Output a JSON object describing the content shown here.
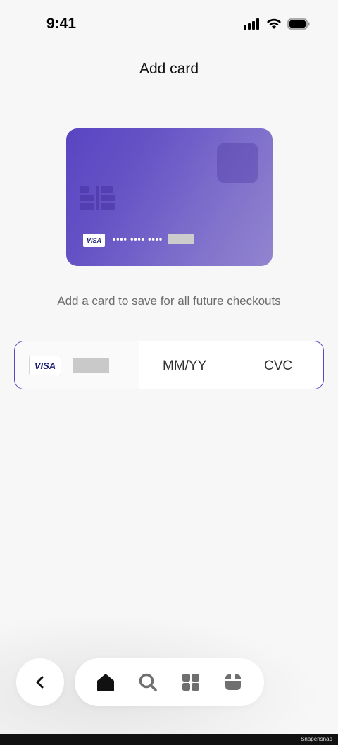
{
  "status_bar": {
    "time": "9:41",
    "icons": [
      "signal-icon",
      "wifi-icon",
      "battery-icon"
    ]
  },
  "header": {
    "title": "Add card"
  },
  "card_preview": {
    "brand": "VISA",
    "number_masked": "•••• •••• ••••"
  },
  "subtitle": "Add a card to save for all future checkouts",
  "card_input": {
    "brand": "VISA",
    "expiry_placeholder": "MM/YY",
    "cvc_placeholder": "CVC"
  },
  "nav": {
    "back_icon": "chevron-left-icon",
    "tabs": [
      {
        "icon": "home-icon",
        "active": true
      },
      {
        "icon": "search-icon",
        "active": false
      },
      {
        "icon": "grid-icon",
        "active": false
      },
      {
        "icon": "box-icon",
        "active": false
      }
    ]
  },
  "footer": {
    "watermark": "Snapensnap"
  },
  "colors": {
    "accent": "#5a45c2",
    "background": "#f7f7f7",
    "active_icon": "#111111",
    "inactive_icon": "#6f6f6f"
  }
}
